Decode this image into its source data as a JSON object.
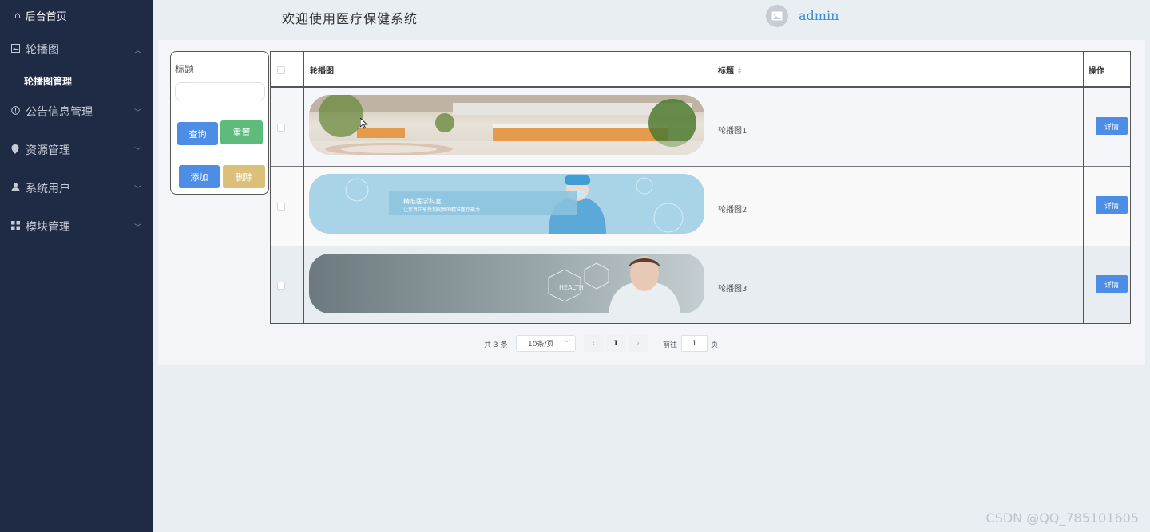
{
  "sidebar": {
    "home_label": "后台首页",
    "items": [
      {
        "label": "轮播图",
        "icon": "image-icon",
        "expanded": true,
        "sub": "轮播图管理"
      },
      {
        "label": "公告信息管理",
        "icon": "info-circle-icon"
      },
      {
        "label": "资源管理",
        "icon": "location-pin-icon"
      },
      {
        "label": "系统用户",
        "icon": "user-icon"
      },
      {
        "label": "模块管理",
        "icon": "grid-icon"
      }
    ]
  },
  "header": {
    "title": "欢迎使用医疗保健系统",
    "username": "admin"
  },
  "search": {
    "title_label": "标题",
    "title_value": "",
    "query_label": "查询",
    "reset_label": "重置",
    "add_label": "添加",
    "delete_label": "删除"
  },
  "table": {
    "columns": {
      "image": "轮播图",
      "title": "标题",
      "actions": "操作"
    },
    "rows": [
      {
        "title": "轮播图1",
        "detail_label": "详情",
        "banner": "hospital-lobby"
      },
      {
        "title": "轮播图2",
        "detail_label": "详情",
        "banner": "doctor-lab",
        "banner_text_1": "精准医学科室",
        "banner_text_2": "让您真正享受到同步的精准医疗能力"
      },
      {
        "title": "轮播图3",
        "detail_label": "详情",
        "banner": "doctor-health",
        "banner_text": "HEALTH"
      }
    ]
  },
  "pagination": {
    "total": "共 3 条",
    "page_size": "10条/页",
    "current_page": "1",
    "goto_label": "前往",
    "goto_value": "1",
    "page_suffix": "页"
  },
  "watermark": "CSDN @QQ_785101605",
  "colors": {
    "sidebar_bg": "#1f2a44",
    "primary": "#4d8de6",
    "success": "#5dbb7c",
    "warning": "#dcc079",
    "username": "#3b8ed6"
  }
}
